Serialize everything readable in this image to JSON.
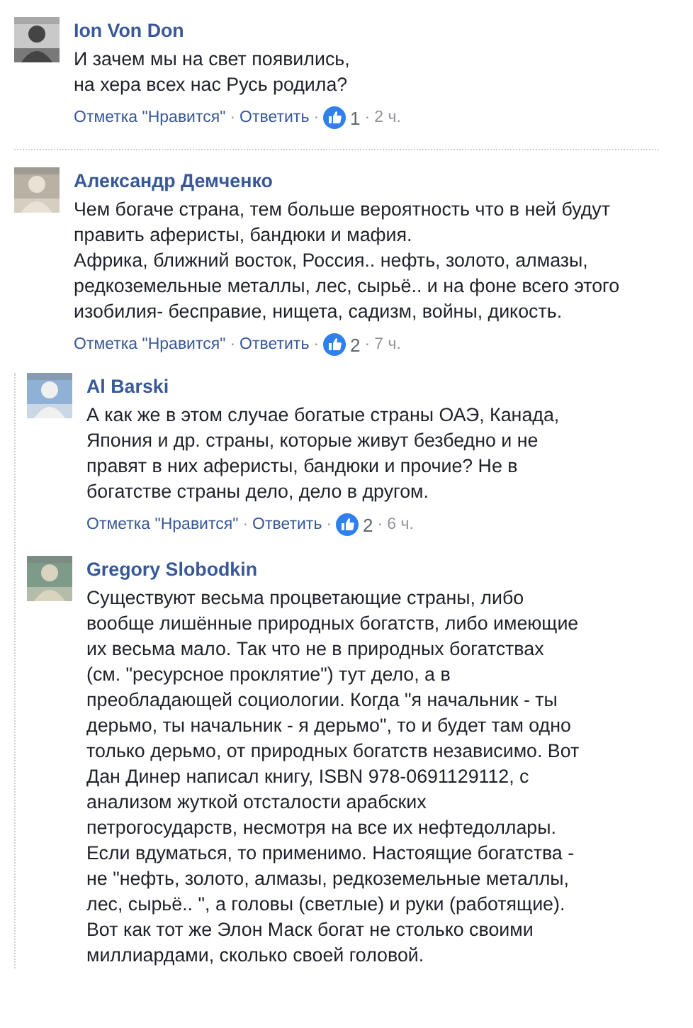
{
  "comments": [
    {
      "author": "Ion Von Don",
      "text": "И зачем мы на свет появились,\nна хера всех нас Русь родила?",
      "like_label": "Отметка \"Нравится\"",
      "reply_label": "Ответить",
      "likes": "1",
      "time": "2 ч.",
      "separator": "·"
    },
    {
      "author": "Александр Демченко",
      "text": "Чем богаче страна, тем больше вероятность что в ней будут\nправить аферисты, бандюки и мафия.\nАфрика, ближний восток, Россия.. нефть, золото, алмазы,\nредкоземельные металлы, лес, сырьё.. и на фоне всего этого\nизобилия- бесправие, нищета, садизм, войны, дикость.",
      "like_label": "Отметка \"Нравится\"",
      "reply_label": "Ответить",
      "likes": "2",
      "time": "7 ч.",
      "separator": "·",
      "replies": [
        {
          "author": "Al Barski",
          "text": "А как же в этом случае богатые страны ОАЭ, Канада,\nЯпония и др. страны, которые живут безбедно и не\nправят в них аферисты, бандюки и прочие? Не в\nбогатстве страны дело, дело в другом.",
          "like_label": "Отметка \"Нравится\"",
          "reply_label": "Ответить",
          "likes": "2",
          "time": "6 ч.",
          "separator": "·"
        },
        {
          "author": "Gregory Slobodkin",
          "text": "Существуют весьма процветающие страны, либо\nвообще лишённые природных богатств, либо имеющие\nих весьма мало. Так что не в природных богатствах\n(см. \"ресурсное проклятие\") тут дело, а в\nпреобладающей социологии. Когда \"я начальник - ты\nдерьмо, ты начальник - я дерьмо\", то и будет там одно\nтолько дерьмо, от природных богатств независимо. Вот\nДан Динер написал книгу, ISBN 978-0691129112, с\nанализом жуткой отсталости арабских\nпетрогосударств, несмотря на все их нефтедоллары.\nЕсли вдуматься, то применимо. Настоящие богатства -\nне \"нефть, золото, алмазы, редкоземельные металлы,\nлес, сырьё.. \", а головы (светлые) и руки (работящие).\nВот как тот же Элон Маск богат не столько своими\nмиллиардами, сколько своей головой."
        }
      ]
    }
  ]
}
